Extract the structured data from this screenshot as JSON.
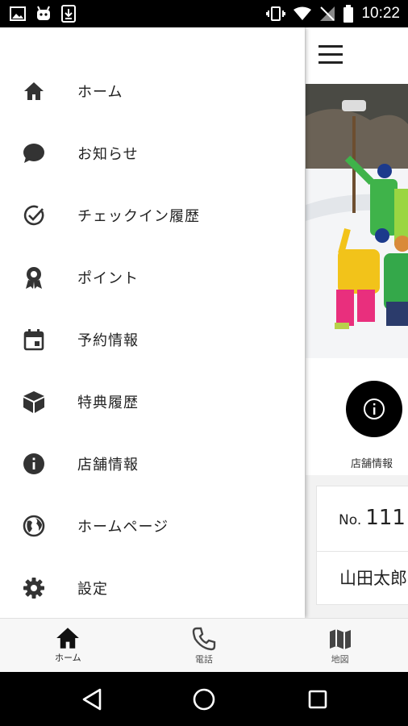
{
  "status_bar": {
    "time": "10:22"
  },
  "drawer": {
    "items": [
      {
        "label": "ホーム",
        "icon": "home-icon"
      },
      {
        "label": "お知らせ",
        "icon": "chat-bubble-icon"
      },
      {
        "label": "チェックイン履歴",
        "icon": "check-circle-icon"
      },
      {
        "label": "ポイント",
        "icon": "award-icon"
      },
      {
        "label": "予約情報",
        "icon": "calendar-icon"
      },
      {
        "label": "特典履歴",
        "icon": "cube-icon"
      },
      {
        "label": "店舗情報",
        "icon": "info-icon"
      },
      {
        "label": "ホームページ",
        "icon": "globe-icon"
      },
      {
        "label": "設定",
        "icon": "gear-icon"
      }
    ]
  },
  "content": {
    "store_info_label": "店舗情報",
    "member_card": {
      "no_prefix": "No.",
      "number": "111",
      "name": "山田太郎"
    }
  },
  "bottom_nav": {
    "items": [
      {
        "label": "ホーム",
        "icon": "home-icon"
      },
      {
        "label": "電話",
        "icon": "phone-icon"
      },
      {
        "label": "地図",
        "icon": "map-icon"
      }
    ]
  },
  "colors": {
    "icon_dark": "#333333",
    "accent_black": "#000000",
    "background_gray": "#f2f2f2"
  }
}
